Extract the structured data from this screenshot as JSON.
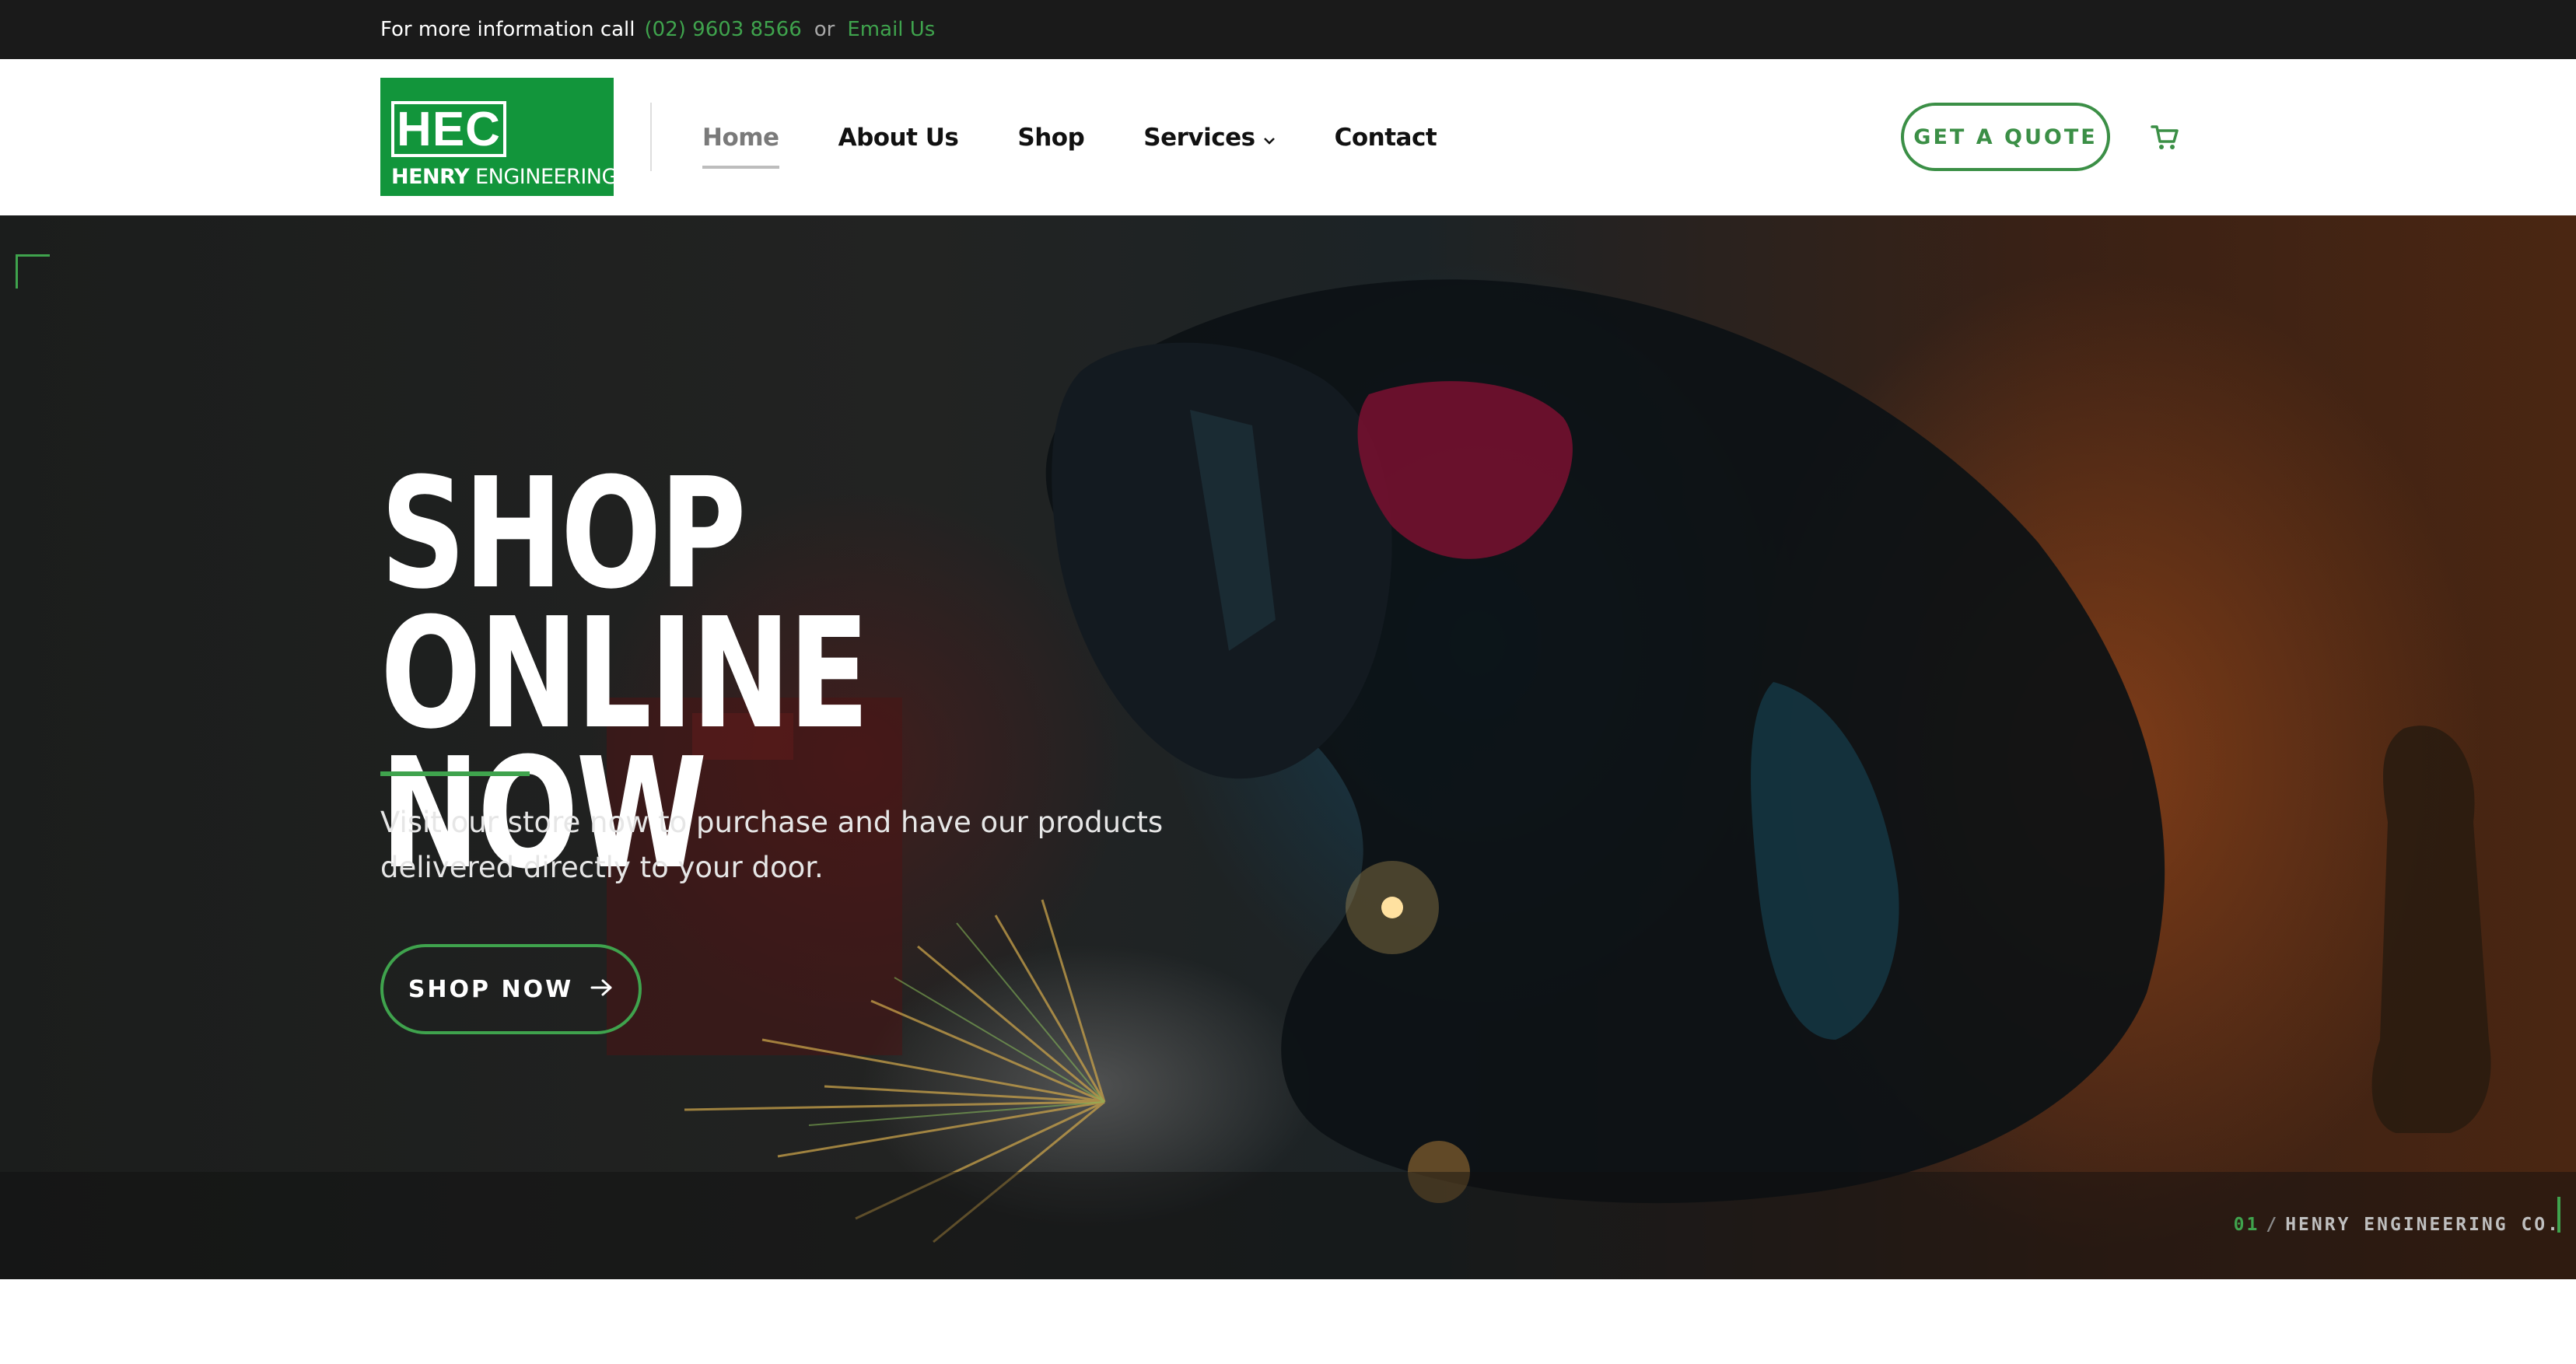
{
  "topbar": {
    "lead": "For more information call",
    "phone": "(02) 9603 8566",
    "or": "or",
    "email": "Email Us"
  },
  "logo": {
    "monogram": "HEC",
    "name_bold": "HENRY",
    "name_rest": " ENGINEERING"
  },
  "nav": {
    "items": [
      {
        "label": "Home",
        "active": true
      },
      {
        "label": "About Us"
      },
      {
        "label": "Shop"
      },
      {
        "label": "Services",
        "has_dropdown": true
      },
      {
        "label": "Contact"
      }
    ]
  },
  "header": {
    "quote_button": "GET A QUOTE",
    "cart_icon": "cart-icon"
  },
  "hero": {
    "title_line1": "SHOP ONLINE",
    "title_line2": "NOW",
    "subtitle": "Visit our store now to purchase and have our products delivered directly to your door.",
    "button_label": "SHOP NOW",
    "button_icon": "arrow-right-icon",
    "slide_number": "01",
    "slide_separator": "/",
    "slide_caption": "HENRY ENGINEERING CO."
  },
  "colors": {
    "accent": "#3fa34d",
    "logo_green": "#12953b",
    "topbar_bg": "#1a1a1a"
  }
}
